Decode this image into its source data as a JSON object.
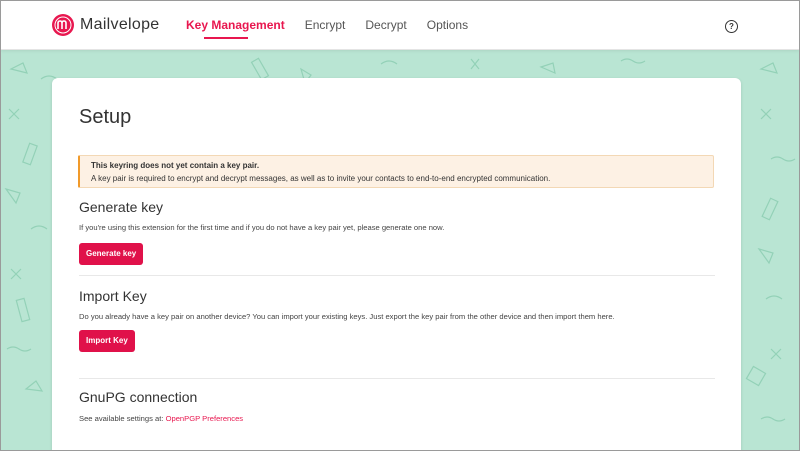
{
  "app": {
    "name": "Mailvelope"
  },
  "nav": {
    "items": [
      {
        "label": "Key Management",
        "active": true
      },
      {
        "label": "Encrypt",
        "active": false
      },
      {
        "label": "Decrypt",
        "active": false
      },
      {
        "label": "Options",
        "active": false
      }
    ],
    "help_icon": "question-circle-icon",
    "help_glyph": "?"
  },
  "page": {
    "title": "Setup"
  },
  "alert": {
    "title": "This keyring does not yet contain a key pair.",
    "text": "A key pair is required to encrypt and decrypt messages, as well as to invite your contacts to end-to-end encrypted communication."
  },
  "generate": {
    "title": "Generate key",
    "text": "If you're using this extension for the first time and if you do not have a key pair yet, please generate one now.",
    "button": "Generate key"
  },
  "import": {
    "title": "Import Key",
    "text": "Do you already have a key pair on another device? You can import your existing keys. Just export the key pair from the other device and then import them here.",
    "button": "Import Key"
  },
  "gnupg": {
    "title": "GnuPG connection",
    "text": "See available settings at:",
    "link": "OpenPGP Preferences"
  },
  "colors": {
    "accent": "#e8174f",
    "background": "#b9e5d3",
    "alert_border": "#f19a2a"
  }
}
